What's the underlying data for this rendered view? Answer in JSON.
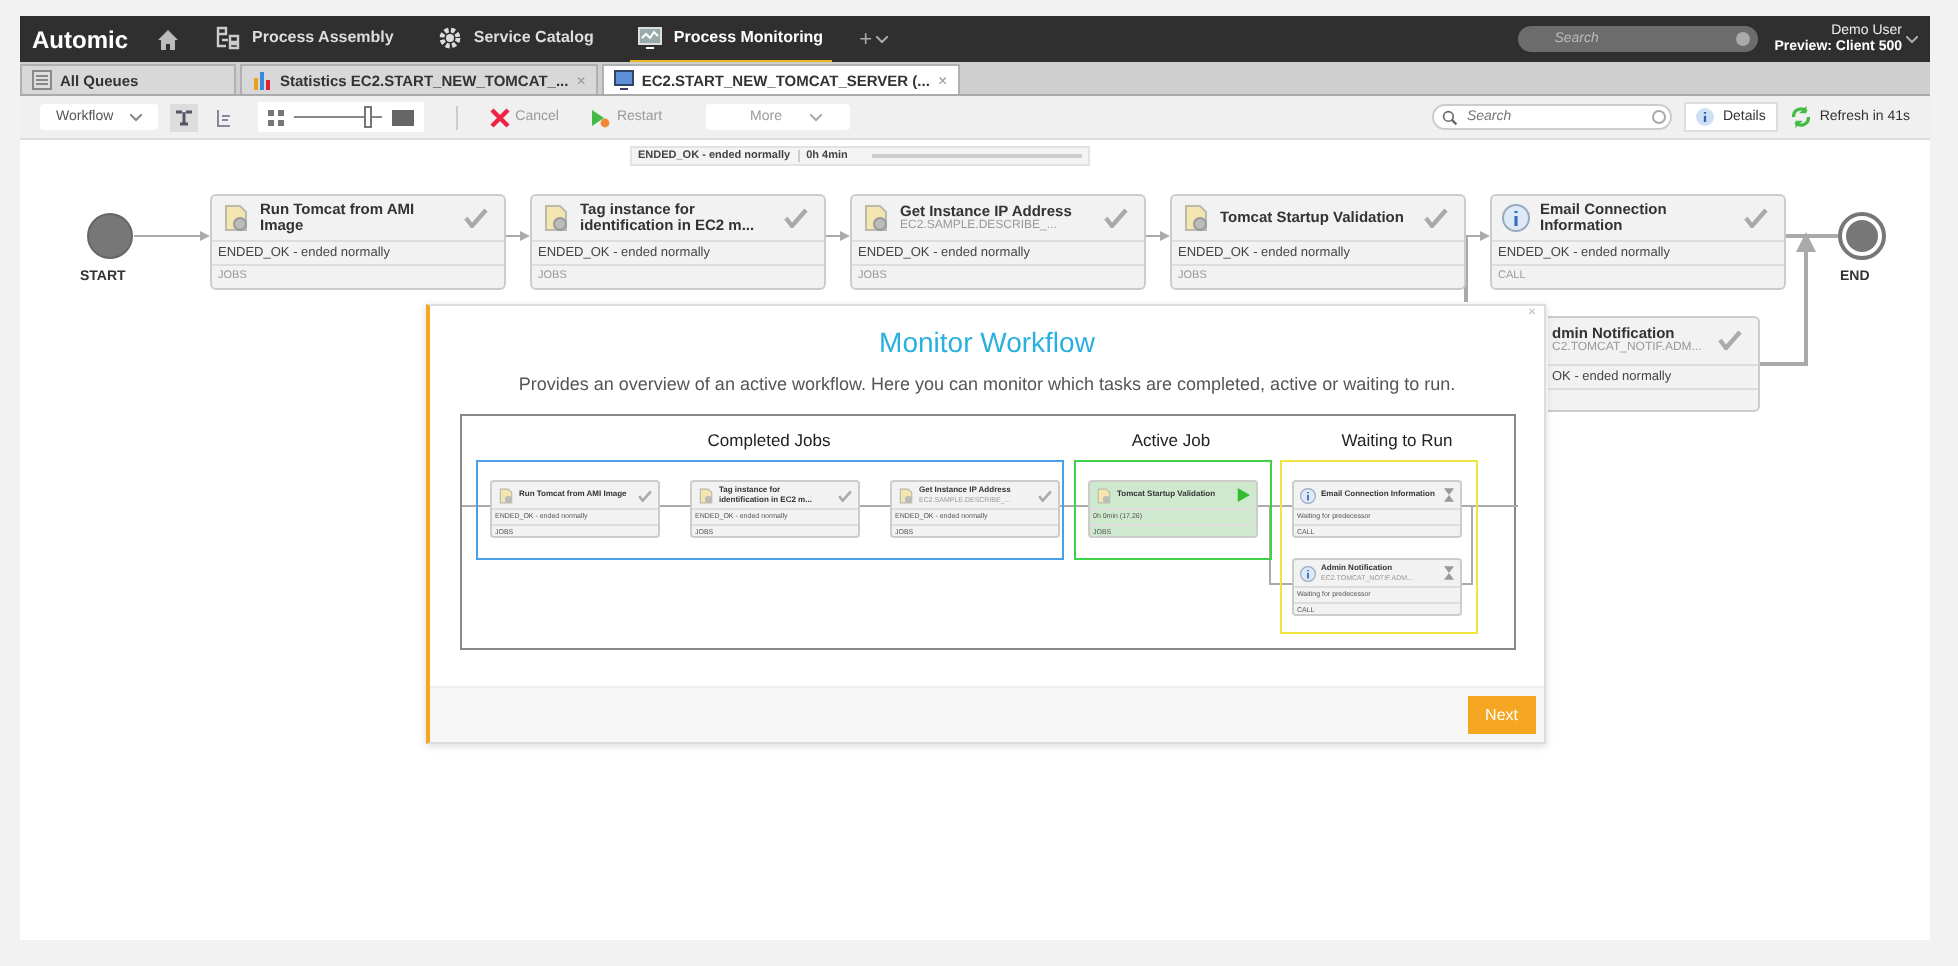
{
  "topbar": {
    "logo": "Automic",
    "nav": [
      {
        "label": "Process Assembly",
        "selected": false
      },
      {
        "label": "Service Catalog",
        "selected": false
      },
      {
        "label": "Process Monitoring",
        "selected": true
      }
    ],
    "add": "+",
    "search": {
      "placeholder": "Search"
    },
    "user": "Demo User",
    "client": "Preview: Client 500"
  },
  "tabs": [
    {
      "label": "All Queues",
      "selected": false
    },
    {
      "label": "Statistics EC2.START_NEW_TOMCAT_...",
      "selected": false,
      "close": "×"
    },
    {
      "label": "EC2.START_NEW_TOMCAT_SERVER (...",
      "selected": true,
      "close": "×"
    }
  ],
  "toolbar": {
    "view": "Workflow",
    "views": [
      {
        "selected": true
      },
      {
        "selected": false
      }
    ],
    "zoom": {
      "level": 0.85
    },
    "actions": [
      {
        "label": "Cancel"
      },
      {
        "label": "Restart"
      }
    ],
    "more": "More",
    "search": {
      "placeholder": "Search"
    },
    "details": "Details",
    "refresh": "Refresh in 41s"
  },
  "status": {
    "text": "ENDED_OK - ended normally",
    "duration": "0h 4min"
  },
  "workflow": {
    "start": "START",
    "end": "END",
    "nodes": [
      {
        "title": "Run Tomcat from AMI Image",
        "status": "ENDED_OK - ended normally",
        "type": "JOBS",
        "kind": "job",
        "done": true
      },
      {
        "title": "Tag instance for identification in EC2 m...",
        "status": "ENDED_OK - ended normally",
        "type": "JOBS",
        "kind": "job",
        "done": true
      },
      {
        "title": "Get Instance IP Address",
        "subtitle": "EC2.SAMPLE.DESCRIBE_...",
        "status": "ENDED_OK - ended normally",
        "type": "JOBS",
        "kind": "job",
        "done": true
      },
      {
        "title": "Tomcat Startup Validation",
        "status": "ENDED_OK - ended normally",
        "type": "JOBS",
        "kind": "job",
        "done": true
      },
      {
        "title": "Email Connection Information",
        "status": "ENDED_OK - ended normally",
        "type": "CALL",
        "kind": "call",
        "done": true
      },
      {
        "title": "dmin Notification",
        "subtitle": "C2.TOMCAT_NOTIF.ADM...",
        "status": "OK - ended normally",
        "done": true
      }
    ]
  },
  "tutorial": {
    "close": "×",
    "title": "Monitor Workflow",
    "description": "Provides an overview of an active workflow. Here you can monitor which tasks are completed, active or waiting to run.",
    "groups": [
      {
        "label": "Completed Jobs",
        "color": "#4a9fe6",
        "nodes": [
          {
            "title": "Run Tomcat from AMI Image",
            "status": "ENDED_OK - ended normally",
            "type": "JOBS",
            "kind": "job",
            "done": true,
            "active": false
          },
          {
            "title": "Tag instance for identification in EC2 m...",
            "status": "ENDED_OK - ended normally",
            "type": "JOBS",
            "kind": "job",
            "done": true,
            "active": false
          },
          {
            "title": "Get Instance IP Address",
            "subtitle": "EC2.SAMPLE.DESCRIBE_...",
            "status": "ENDED_OK - ended normally",
            "type": "JOBS",
            "kind": "job",
            "done": true,
            "active": false
          }
        ]
      },
      {
        "label": "Active Job",
        "color": "#3ed24a",
        "nodes": [
          {
            "title": "Tomcat Startup Validation",
            "status": "0h 0min (17.26)",
            "type": "JOBS",
            "kind": "job",
            "done": false,
            "active": true
          }
        ]
      },
      {
        "label": "Waiting to Run",
        "color": "#f0e53c",
        "nodes": [
          {
            "title": "Email Connection Information",
            "status": "Waiting for predecessor",
            "type": "CALL",
            "kind": "call",
            "done": false,
            "active": false
          },
          {
            "title": "Admin Notification",
            "subtitle": "EC2.TOMCAT_NOTIF.ADM...",
            "status": "Waiting for predecessor",
            "type": "CALL",
            "kind": "call",
            "done": false,
            "active": false
          }
        ]
      }
    ],
    "next": "Next"
  }
}
